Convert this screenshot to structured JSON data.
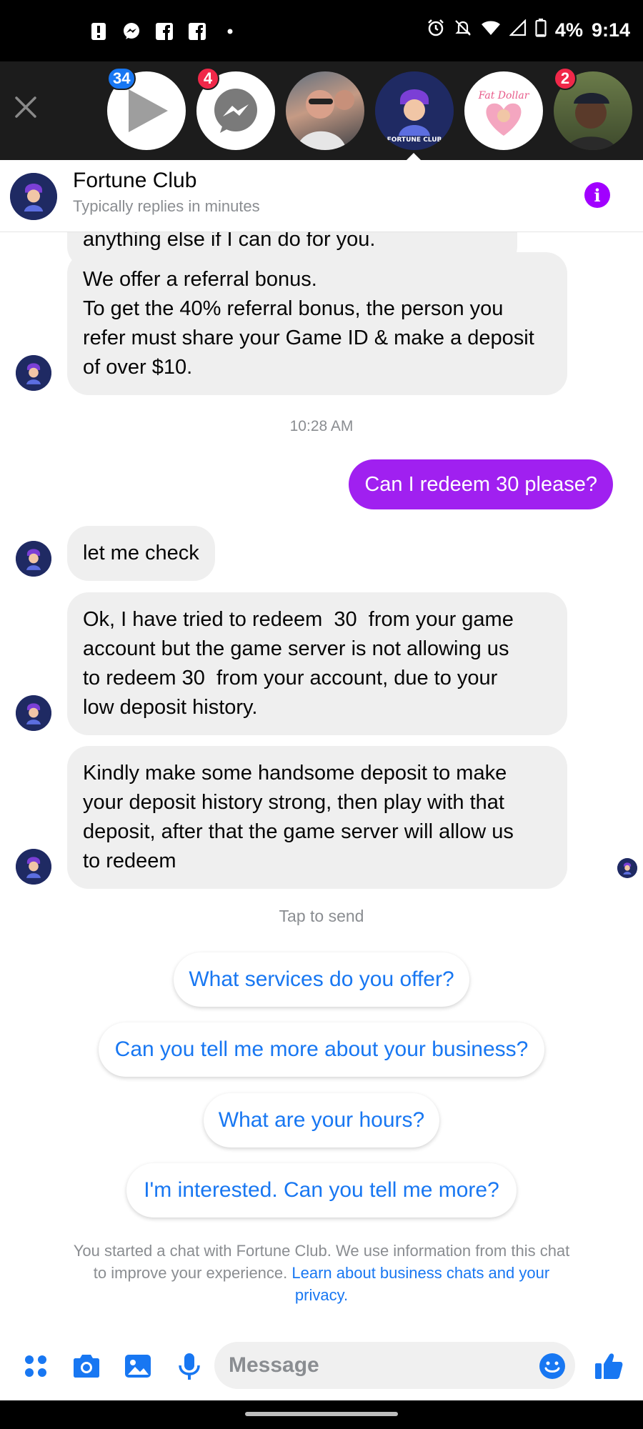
{
  "status_bar": {
    "battery": "4%",
    "time": "9:14",
    "left_icons": [
      "alert-icon",
      "messenger-icon",
      "facebook-icon",
      "facebook-icon",
      "dot-icon"
    ],
    "right_icons": [
      "alarm-icon",
      "mute-icon",
      "wifi-icon",
      "signal-icon",
      "battery-icon"
    ]
  },
  "chat_heads": {
    "items": [
      {
        "name": "video-play-head",
        "badge": "34",
        "badge_color": "#1877f2"
      },
      {
        "name": "messenger-head",
        "badge": "4",
        "badge_color": "#f02849"
      },
      {
        "name": "contact-photo-head",
        "badge": "",
        "badge_color": ""
      },
      {
        "name": "fortune-club-head",
        "badge": "",
        "badge_color": "",
        "active": true
      },
      {
        "name": "fat-dollar-head",
        "badge": "",
        "badge_color": ""
      },
      {
        "name": "contact-man-head",
        "badge": "2",
        "badge_color": "#f02849"
      }
    ],
    "fat_dollar_logo_text": "Fat Dollar",
    "fortune_club_logo_text": "FORTUNE CLUB"
  },
  "header": {
    "title": "Fortune Club",
    "subtitle": "Typically replies in minutes"
  },
  "messages": {
    "partial_top": "anything else if I can do for you.",
    "referral": [
      "We offer a referral bonus.",
      "To get the 40% referral bonus, the person you",
      "refer must share your Game ID & make a deposit",
      "of over $10."
    ],
    "timestamp": "10:28 AM",
    "outgoing": "Can I redeem 30 please?",
    "check": "let me check",
    "redeem_fail": [
      "Ok, I have tried to redeem  30  from your game",
      "account but the game server is not allowing us",
      "to redeem 30  from your account, due to your",
      "low deposit history."
    ],
    "deposit": [
      "Kindly make some handsome deposit to make",
      "your deposit history strong, then play with that",
      "deposit, after that the game server will allow us",
      "to redeem"
    ]
  },
  "tap_to_send": "Tap to send",
  "quick_replies": [
    "What services do you offer?",
    "Can you tell me more about your business?",
    "What are your hours?",
    "I'm interested. Can you tell me more?"
  ],
  "disclaimer": {
    "text": "You started a chat with Fortune Club. We use information from this chat to improve your experience. ",
    "link": "Learn about business chats and your privacy."
  },
  "composer": {
    "placeholder": "Message"
  },
  "colors": {
    "accent": "#a020f0",
    "link": "#1877f2",
    "bubble_in": "#efefef"
  }
}
